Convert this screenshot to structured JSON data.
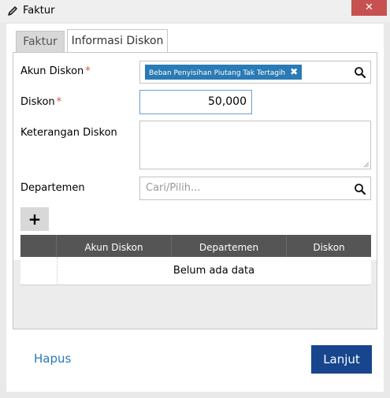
{
  "window": {
    "title": "Faktur",
    "close_label": "✕"
  },
  "tabs": [
    {
      "label": "Faktur",
      "active": false
    },
    {
      "label": "Informasi Diskon",
      "active": true
    }
  ],
  "form": {
    "akun_diskon": {
      "label": "Akun Diskon",
      "required_mark": "*",
      "selected_tag": "Beban Penyisihan Piutang Tak Tertagih",
      "remove_glyph": "✖"
    },
    "diskon": {
      "label": "Diskon",
      "required_mark": "*",
      "value": "50,000"
    },
    "keterangan": {
      "label": "Keterangan Diskon",
      "value": ""
    },
    "departemen": {
      "label": "Departemen",
      "placeholder": "Cari/Pilih..."
    }
  },
  "add_button": {
    "label": "+"
  },
  "table": {
    "columns": [
      "Akun Diskon",
      "Departemen",
      "Diskon"
    ],
    "empty_text": "Belum ada data"
  },
  "footer": {
    "delete_label": "Hapus",
    "next_label": "Lanjut"
  },
  "colors": {
    "accent": "#17468f",
    "tag": "#2a7ab5",
    "header": "#555555",
    "close": "#c75050"
  },
  "icons": {
    "title": "pencil-icon",
    "search": "search-icon"
  }
}
